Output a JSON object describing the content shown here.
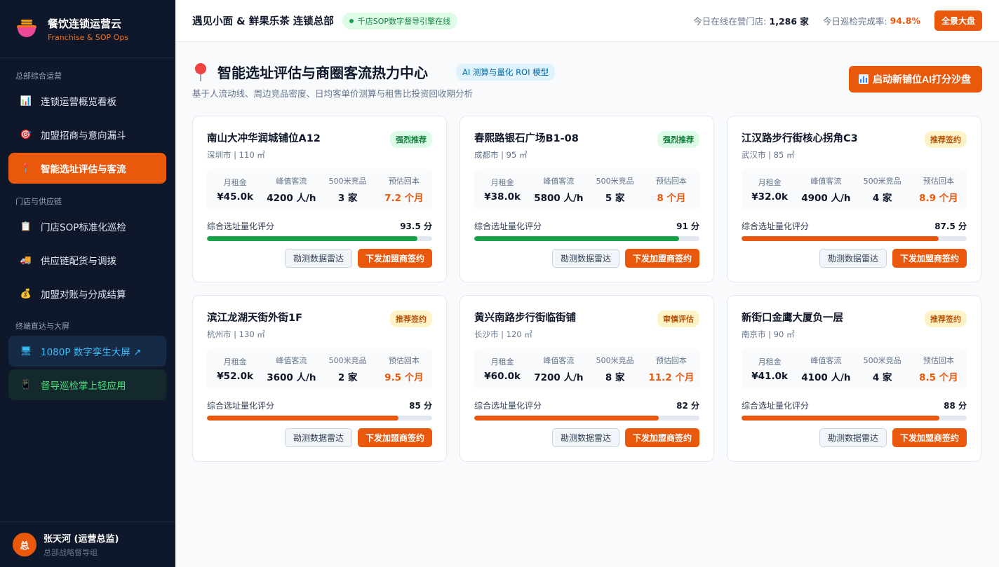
{
  "brand": {
    "title": "餐饮连锁运营云",
    "subtitle": "Franchise & SOP Ops"
  },
  "nav": {
    "sections": [
      "总部综合运营",
      "门店与供应链",
      "终端直达与大屏"
    ],
    "items": [
      {
        "label": "连锁运营概览看板",
        "icon": "chart-icon"
      },
      {
        "label": "加盟招商与意向漏斗",
        "icon": "target-icon"
      },
      {
        "label": "智能选址评估与客流",
        "icon": "pin-icon"
      },
      {
        "label": "门店SOP标准化巡检",
        "icon": "clipboard-icon"
      },
      {
        "label": "供应链配货与调拨",
        "icon": "truck-icon"
      },
      {
        "label": "加盟对账与分成结算",
        "icon": "money-bag-icon"
      },
      {
        "label": "1080P 数字孪生大屏 ↗",
        "icon": "monitor-icon"
      },
      {
        "label": "督导巡检掌上轻应用",
        "icon": "phone-icon"
      }
    ]
  },
  "user": {
    "avatar": "总",
    "name": "张天河 (运营总监)",
    "role": "总部战略督导组"
  },
  "header": {
    "company": "遇见小面 & 鲜果乐茶 连锁总部",
    "status": "千店SOP数字督导引擎在线",
    "stores_label": "今日在线在营门店:",
    "stores_value": "1,286 家",
    "patrol_label": "今日巡检完成率:",
    "patrol_value": "94.8%",
    "dashboard_btn": "全景大盘"
  },
  "page": {
    "title": "智能选址评估与商圈客流热力中心",
    "badge": "AI 测算与量化 ROI 模型",
    "subtitle": "基于人流动线、周边竞品密度、日均客单价测算与租售比投资回收期分析",
    "sandbox_btn": "启动新铺位AI打分沙盘"
  },
  "labels": {
    "rent": "月租金",
    "traffic": "峰值客流",
    "competitors": "500米竞品",
    "payback": "预估回本",
    "score": "综合选址量化评分",
    "radar_btn": "勘测数据雷达",
    "sign_btn": "下发加盟商签约"
  },
  "colors": {
    "accent": "#ea580c",
    "green": "#16a34a"
  },
  "sites": [
    {
      "name": "南山大冲华润城铺位A12",
      "meta": "深圳市 | 110 ㎡",
      "tag": "强烈推荐",
      "tag_tone": "green",
      "rent": "¥45.0k",
      "traffic": "4200 人/h",
      "competitors": "3 家",
      "payback": "7.2 个月",
      "score_text": "93.5 分",
      "score": 93.5
    },
    {
      "name": "春熙路银石广场B1-08",
      "meta": "成都市 | 95 ㎡",
      "tag": "强烈推荐",
      "tag_tone": "green",
      "rent": "¥38.0k",
      "traffic": "5800 人/h",
      "competitors": "5 家",
      "payback": "8 个月",
      "score_text": "91 分",
      "score": 91
    },
    {
      "name": "江汉路步行街核心拐角C3",
      "meta": "武汉市 | 85 ㎡",
      "tag": "推荐签约",
      "tag_tone": "amber",
      "rent": "¥32.0k",
      "traffic": "4900 人/h",
      "competitors": "4 家",
      "payback": "8.9 个月",
      "score_text": "87.5 分",
      "score": 87.5
    },
    {
      "name": "滨江龙湖天街外街1F",
      "meta": "杭州市 | 130 ㎡",
      "tag": "推荐签约",
      "tag_tone": "amber",
      "rent": "¥52.0k",
      "traffic": "3600 人/h",
      "competitors": "2 家",
      "payback": "9.5 个月",
      "score_text": "85 分",
      "score": 85
    },
    {
      "name": "黄兴南路步行街临街铺",
      "meta": "长沙市 | 120 ㎡",
      "tag": "审慎评估",
      "tag_tone": "amber",
      "rent": "¥60.0k",
      "traffic": "7200 人/h",
      "competitors": "8 家",
      "payback": "11.2 个月",
      "score_text": "82 分",
      "score": 82
    },
    {
      "name": "新街口金鹰大厦负一层",
      "meta": "南京市 | 90 ㎡",
      "tag": "推荐签约",
      "tag_tone": "amber",
      "rent": "¥41.0k",
      "traffic": "4100 人/h",
      "competitors": "4 家",
      "payback": "8.5 个月",
      "score_text": "88 分",
      "score": 88
    }
  ]
}
